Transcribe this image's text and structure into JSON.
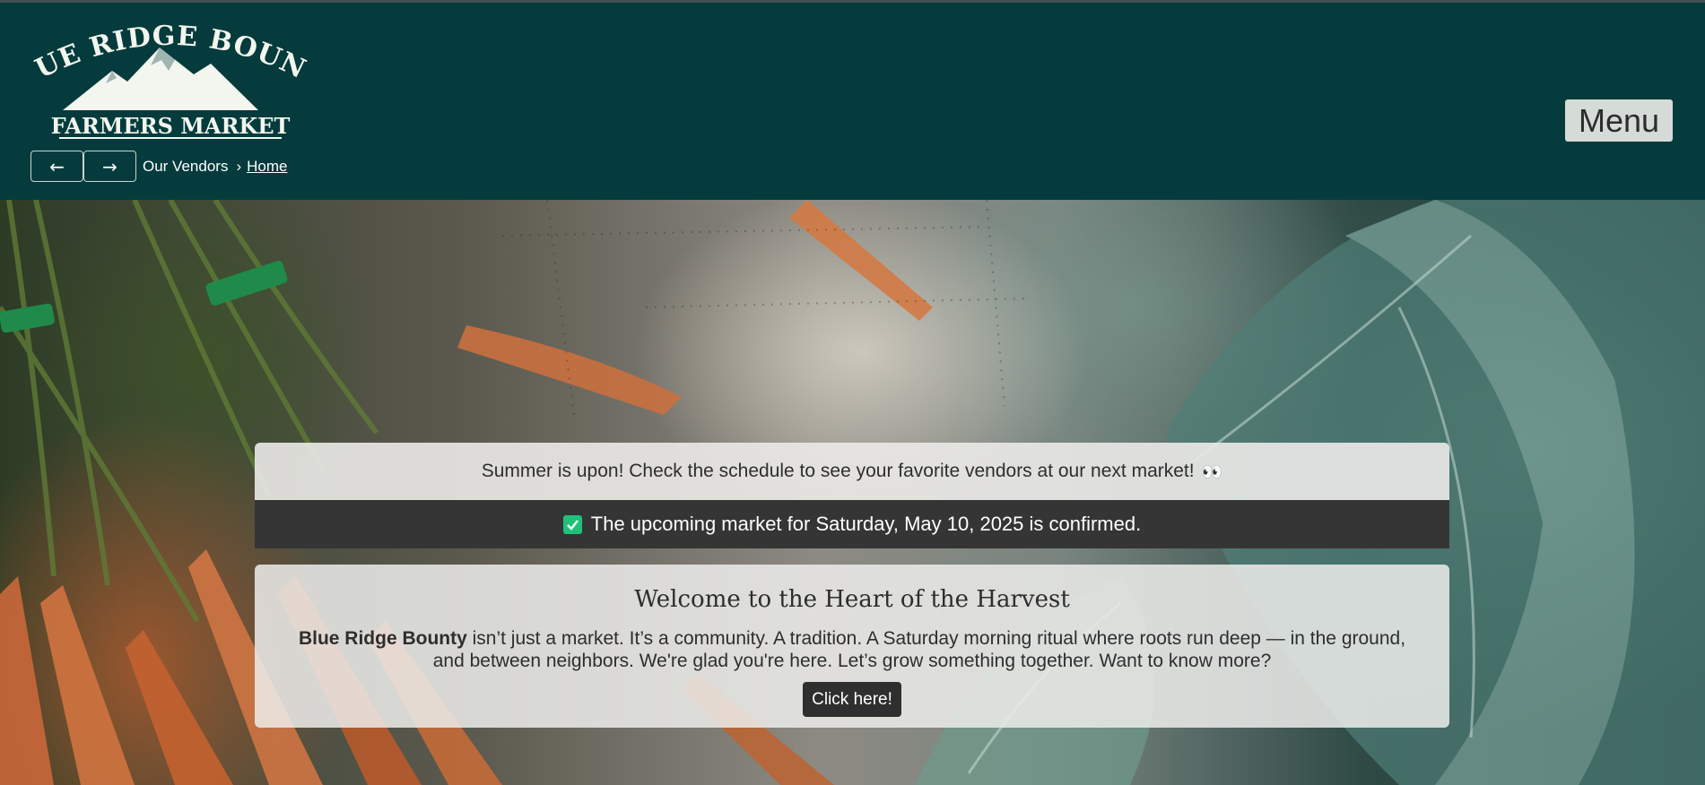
{
  "brand": {
    "logo_line1": "BLUE RIDGE BOUNTY",
    "logo_line2": "FARMERS MARKET"
  },
  "nav": {
    "back_icon": "←",
    "forward_icon": "→",
    "breadcrumb_current": "Our Vendors",
    "breadcrumb_sep": "›",
    "breadcrumb_home": "Home",
    "menu_label": "Menu"
  },
  "announcement": {
    "text": "Summer is upon! Check the schedule to see your favorite vendors at our next market!",
    "emoji": "👀"
  },
  "confirmation": {
    "text": "The upcoming market for Saturday, May 10, 2025 is confirmed."
  },
  "welcome": {
    "title": "Welcome to the Heart of the Harvest",
    "brand_name": "Blue Ridge Bounty",
    "body": " isn’t just a market. It’s a community. A tradition. A Saturday morning ritual where roots run deep — in the ground, and between neighbors. We're glad you're here. Let’s grow something together. Want to know more?",
    "cta_label": "Click here!"
  },
  "colors": {
    "header_bg": "#053b3c",
    "confirm_bg": "#353535",
    "check_green": "#20c27a",
    "cta_bg": "#2f2f2f"
  }
}
